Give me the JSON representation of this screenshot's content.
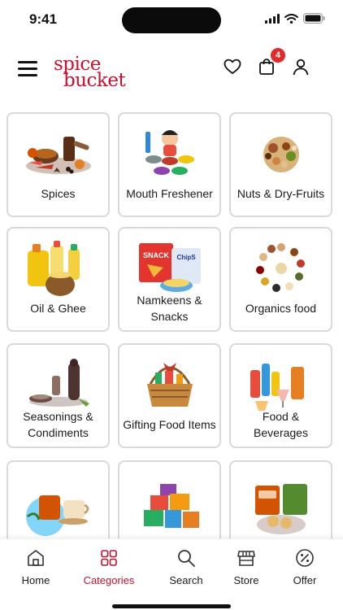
{
  "status_bar": {
    "time": "9:41"
  },
  "brand": {
    "logo_line1": "spice",
    "logo_line2": "bucket",
    "color": "#c8102e"
  },
  "header": {
    "cart_count": "4"
  },
  "categories": [
    {
      "label": "Spices",
      "icon": "spices-icon"
    },
    {
      "label": "Mouth Freshener",
      "icon": "mouth-freshener-icon"
    },
    {
      "label": "Nuts & Dry-Fruits",
      "icon": "nuts-dry-fruits-icon"
    },
    {
      "label": "Oil & Ghee",
      "icon": "oil-ghee-icon"
    },
    {
      "label": "Namkeens & Snacks",
      "icon": "namkeens-snacks-icon",
      "pack_text": "SNACK",
      "bag_text": "ChipS"
    },
    {
      "label": "Organics food",
      "icon": "organics-food-icon"
    },
    {
      "label": "Seasonings & Condiments",
      "icon": "seasonings-icon"
    },
    {
      "label": "Gifting Food Items",
      "icon": "gift-basket-icon"
    },
    {
      "label": "Food & Beverages",
      "icon": "food-beverages-icon"
    },
    {
      "label": "",
      "icon": "tea-cups-icon"
    },
    {
      "label": "",
      "icon": "grocery-boxes-icon"
    },
    {
      "label": "",
      "icon": "packaged-snacks-icon"
    }
  ],
  "nav": {
    "items": [
      {
        "label": "Home",
        "icon": "home-icon"
      },
      {
        "label": "Categories",
        "icon": "categories-icon",
        "active": true
      },
      {
        "label": "Search",
        "icon": "search-icon"
      },
      {
        "label": "Store",
        "icon": "store-icon"
      },
      {
        "label": "Offer",
        "icon": "offer-icon"
      }
    ],
    "active_color": "#c8102e"
  }
}
